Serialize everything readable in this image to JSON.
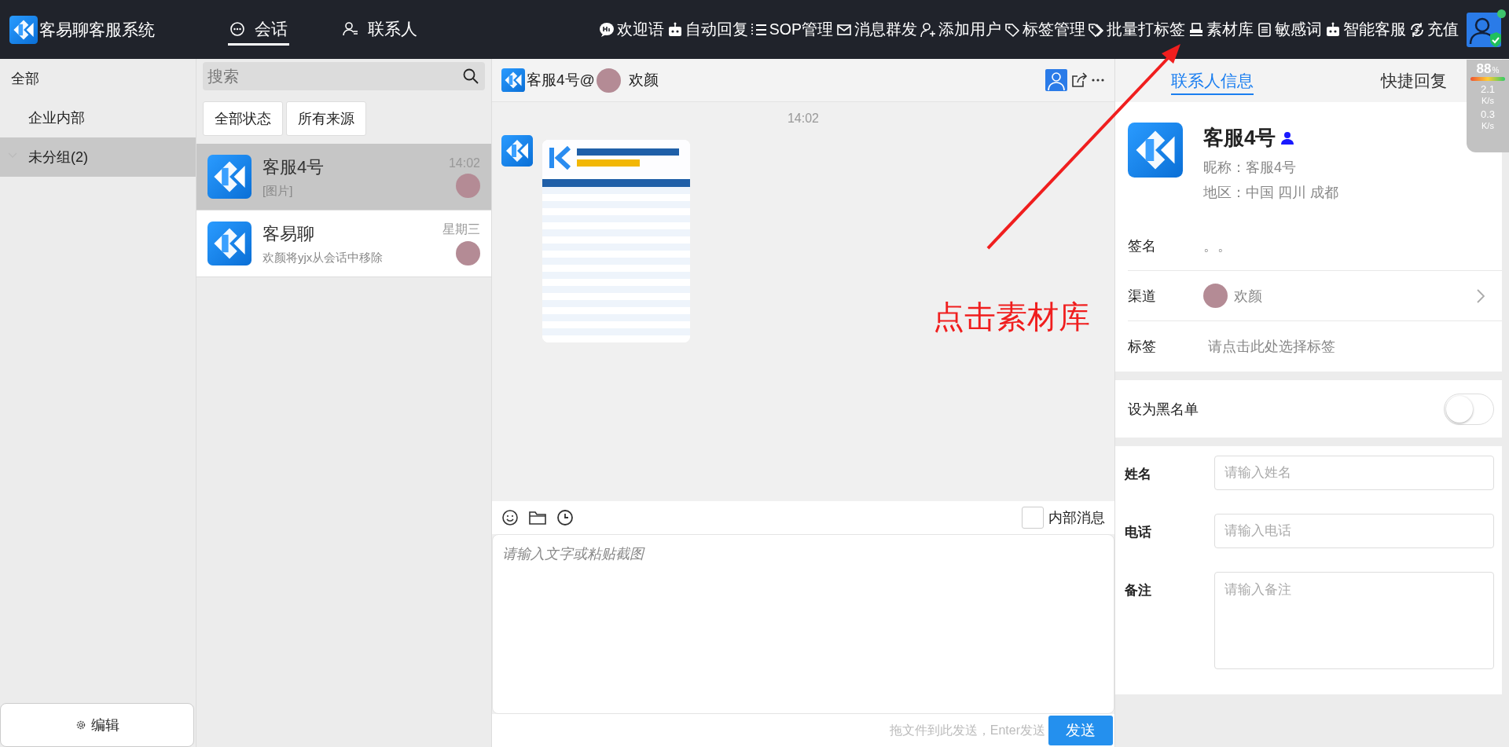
{
  "app": {
    "title": "客易聊客服系统"
  },
  "nav_tabs": [
    {
      "label": "会话",
      "selected": true
    },
    {
      "label": "联系人",
      "selected": false
    }
  ],
  "toolbar": [
    "欢迎语",
    "自动回复",
    "SOP管理",
    "消息群发",
    "添加用户",
    "标签管理",
    "批量打标签",
    "素材库",
    "敏感词",
    "智能客服",
    "充值"
  ],
  "groups": [
    {
      "label": "全部",
      "selected": false,
      "children": [
        {
          "label": "企业内部",
          "selected": false
        },
        {
          "label": "未分组(2)",
          "selected": true
        }
      ]
    }
  ],
  "edit_button": "编辑",
  "search": {
    "placeholder": "搜索"
  },
  "filters": [
    "全部状态",
    "所有来源"
  ],
  "conversations": [
    {
      "name": "客服4号",
      "preview": "[图片]",
      "time": "14:02",
      "selected": true
    },
    {
      "name": "客易聊",
      "preview": "欢颜将yjx从会话中移除",
      "time": "星期三",
      "selected": false
    }
  ],
  "chat": {
    "title": "客服4号@",
    "channel": "欢颜",
    "time": "14:02",
    "internal_label": "内部消息",
    "internal_checked": false,
    "placeholder": "请输入文字或粘贴截图",
    "hint": "拖文件到此发送，Enter发送",
    "send": "发送"
  },
  "contact_tabs": [
    {
      "label": "联系人信息",
      "selected": true
    },
    {
      "label": "快捷回复",
      "selected": false
    }
  ],
  "contact": {
    "name": "客服4号",
    "nickname": "昵称：客服4号",
    "region": "地区：中国 四川 成都",
    "rows": [
      {
        "label": "签名",
        "value": "。。",
        "kind": "text"
      },
      {
        "label": "渠道",
        "value": "欢颜",
        "kind": "channel"
      },
      {
        "label": "标签",
        "value": "请点击此处选择标签",
        "kind": "picker"
      }
    ]
  },
  "blacklist": {
    "label": "设为黑名单",
    "on": false
  },
  "form": [
    {
      "label": "姓名",
      "placeholder": "请输入姓名",
      "kind": "input"
    },
    {
      "label": "电话",
      "placeholder": "请输入电话",
      "kind": "input"
    },
    {
      "label": "备注",
      "placeholder": "请输入备注",
      "kind": "textarea"
    }
  ],
  "annotation": {
    "text": "点击素材库"
  },
  "net_widget": {
    "battery": "88",
    "unit": "%",
    "up": "2.1",
    "up_unit": "K/s",
    "down": "0.3",
    "down_unit": "K/s"
  }
}
